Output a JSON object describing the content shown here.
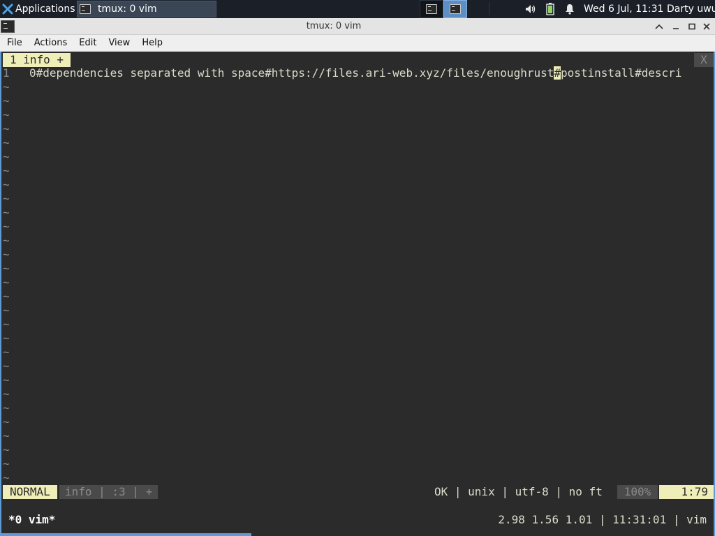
{
  "panel": {
    "applications_label": "Applications",
    "task_label": "tmux: 0 vim",
    "clock": "Wed  6 Jul, 11:31",
    "user": "Darty uwu",
    "tray_icons": [
      "volume-icon",
      "battery-icon",
      "notification-bell-icon"
    ]
  },
  "window": {
    "title": "tmux: 0 vim",
    "buttons": {
      "up": "^",
      "minimize": "—",
      "maximize": "□",
      "close": "✕"
    }
  },
  "menubar": {
    "items": [
      "File",
      "Actions",
      "Edit",
      "View",
      "Help"
    ]
  },
  "vim": {
    "tab_label": "1 info +",
    "tab_close": "X",
    "line_number": "1",
    "line_before_cursor": "0#dependencies separated with space#https://files.ari-web.xyz/files/enoughrust",
    "line_cursor_char": "#",
    "line_after_cursor": "postinstall#descri",
    "tilde": "~",
    "statusline": {
      "mode": "NORMAL",
      "file_segment": "info | :3 | +",
      "right": "OK | unix | utf-8 | no ft",
      "percent": "100%",
      "position": "1:79"
    }
  },
  "tmux": {
    "left": "*0 vim*",
    "right": "2.98 1.56 1.01 | 11:31:01 | vim"
  },
  "colors": {
    "panel_bg": "#1a1f28",
    "terminal_bg": "#2b2b2b",
    "accent_yellow": "#f0eeb8",
    "window_border": "#5e9bd6"
  }
}
